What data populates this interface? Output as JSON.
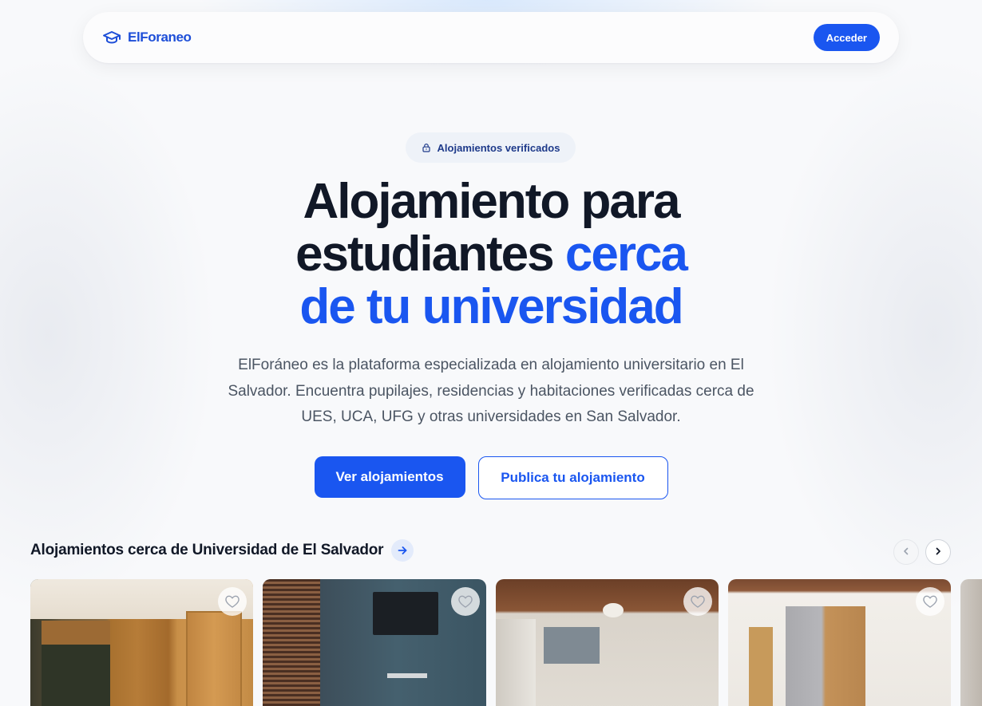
{
  "navbar": {
    "brand": "ElForaneo",
    "brand_icon": "graduation-cap-icon",
    "login_label": "Acceder"
  },
  "hero": {
    "badge_icon": "lock-icon",
    "badge": "Alojamientos verificados",
    "title_line1": "Alojamiento para",
    "title_line2_dark": "estudiantes",
    "title_line2_accent": "cerca",
    "title_line3_accent": "de tu universidad",
    "description": "ElForáneo es la plataforma especializada en alojamiento universitario en El Salvador. Encuentra pupilajes, residencias y habitaciones verificadas cerca de UES, UCA, UFG y otras universidades en San Salvador.",
    "cta_primary": "Ver alojamientos",
    "cta_secondary": "Publica tu alojamiento"
  },
  "section": {
    "title": "Alojamientos cerca de Universidad de El Salvador",
    "arrow_icon": "arrow-right-icon",
    "prev_icon": "chevron-left-icon",
    "next_icon": "chevron-right-icon"
  },
  "listings": [
    {
      "favorite_icon": "heart-icon"
    },
    {
      "favorite_icon": "heart-icon"
    },
    {
      "favorite_icon": "heart-icon"
    },
    {
      "favorite_icon": "heart-icon"
    },
    {
      "favorite_icon": "heart-icon"
    }
  ],
  "colors": {
    "primary": "#1a56f0",
    "text_dark": "#111827",
    "text_muted": "#4b5563",
    "badge_bg": "#eef2f8"
  }
}
